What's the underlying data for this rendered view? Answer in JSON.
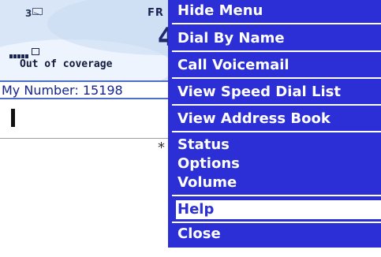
{
  "status": {
    "message_count": "3",
    "day": "FR",
    "time": "4",
    "coverage": "Out of coverage"
  },
  "phone": {
    "my_number": "My Number: 15198",
    "input_value": "",
    "truncated_text": "* N"
  },
  "menu": {
    "items": [
      {
        "label": "Hide Menu"
      },
      {
        "label": "Dial By Name"
      },
      {
        "label": "Call Voicemail"
      },
      {
        "label": "View Speed Dial List"
      },
      {
        "label": "View Address Book"
      },
      {
        "label": "Status"
      },
      {
        "label": "Options"
      },
      {
        "label": "Volume"
      },
      {
        "label": "Help"
      },
      {
        "label": "Close"
      }
    ],
    "selected_index": 8
  },
  "colors": {
    "menu_bg": "#2c2fd6",
    "menu_text": "#ffffff",
    "header_bg": "#d9e6f7",
    "accent": "#17248c"
  }
}
